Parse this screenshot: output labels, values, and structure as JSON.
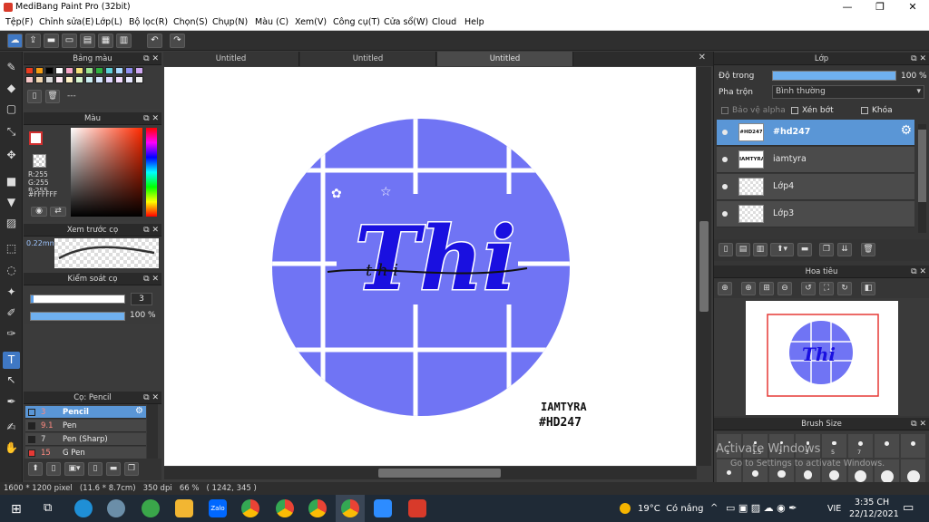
{
  "app": {
    "title": "MediBang Paint Pro (32bit)"
  },
  "menu": [
    "Tệp(F)",
    "Chỉnh sửa(E)",
    "Lớp(L)",
    "Bộ lọc(R)",
    "Chọn(S)",
    "Chụp(N)",
    "Màu (C)",
    "Xem(V)",
    "Công cụ(T)",
    "Cửa sổ(W)",
    "Cloud",
    "Help"
  ],
  "tabs": [
    "Untitled",
    "Untitled",
    "Untitled"
  ],
  "palette": {
    "title": "Bảng màu",
    "dash_label": "---"
  },
  "color": {
    "title": "Màu",
    "r": "R:255",
    "g": "G:255",
    "b": "B:255",
    "hex": "#FFFFFF"
  },
  "brush_preview": {
    "title": "Xem trước cọ",
    "size": "0.22mm"
  },
  "brush_control": {
    "title": "Kiểm soát cọ",
    "size_value": "3",
    "opacity": "100 %",
    "opacity_fraction": 1.0
  },
  "brush_list": {
    "title": "Cọ: Pencil",
    "items": [
      {
        "size": "3",
        "name": "Pencil",
        "selected": true,
        "color": "#3a78d0"
      },
      {
        "size": "9.1",
        "name": "Pen",
        "selected": false,
        "color": "#222222"
      },
      {
        "size": "7",
        "name": "Pen (Sharp)",
        "selected": false,
        "color": "#222222"
      },
      {
        "size": "15",
        "name": "G Pen",
        "selected": false,
        "color": "#e53935"
      }
    ]
  },
  "artwork": {
    "circle_color": "#7074f4",
    "letters": "Thi",
    "small_letters": "t h i",
    "caption1": "IAMTYRA",
    "caption2": "#HD247"
  },
  "layer_panel": {
    "title": "Lớp",
    "opacity_label": "Độ trong",
    "opacity_value": "100 %",
    "blend_label": "Pha trộn",
    "blend_value": "Bình thường",
    "protect_alpha": "Bảo vệ alpha",
    "clipping": "Xén bớt",
    "lock": "Khóa",
    "layers": [
      {
        "name": "#hd247",
        "thumb": "#HD247",
        "selected": true
      },
      {
        "name": "iamtyra",
        "thumb": "IAMTYRA",
        "selected": false
      },
      {
        "name": "Lớp4",
        "thumb": "",
        "selected": false
      },
      {
        "name": "Lớp3",
        "thumb": "",
        "selected": false
      }
    ]
  },
  "navigator": {
    "title": "Hoa tiêu"
  },
  "brush_size": {
    "title": "Brush Size",
    "labels": [
      "1",
      "1.5",
      "2",
      "3",
      "5",
      "7"
    ]
  },
  "watermark": {
    "line1": "Activate Windows",
    "line2": "Go to Settings to activate Windows."
  },
  "statusbar": {
    "text": "1600 * 1200 pixel   (11.6 * 8.7cm)   350 dpi   66 %   ( 1242, 345 )"
  },
  "taskbar": {
    "weather": "19°C  Có nắng",
    "lang": "VIE",
    "time": "3:35 CH",
    "date": "22/12/2021",
    "zalo": "Zalo"
  }
}
